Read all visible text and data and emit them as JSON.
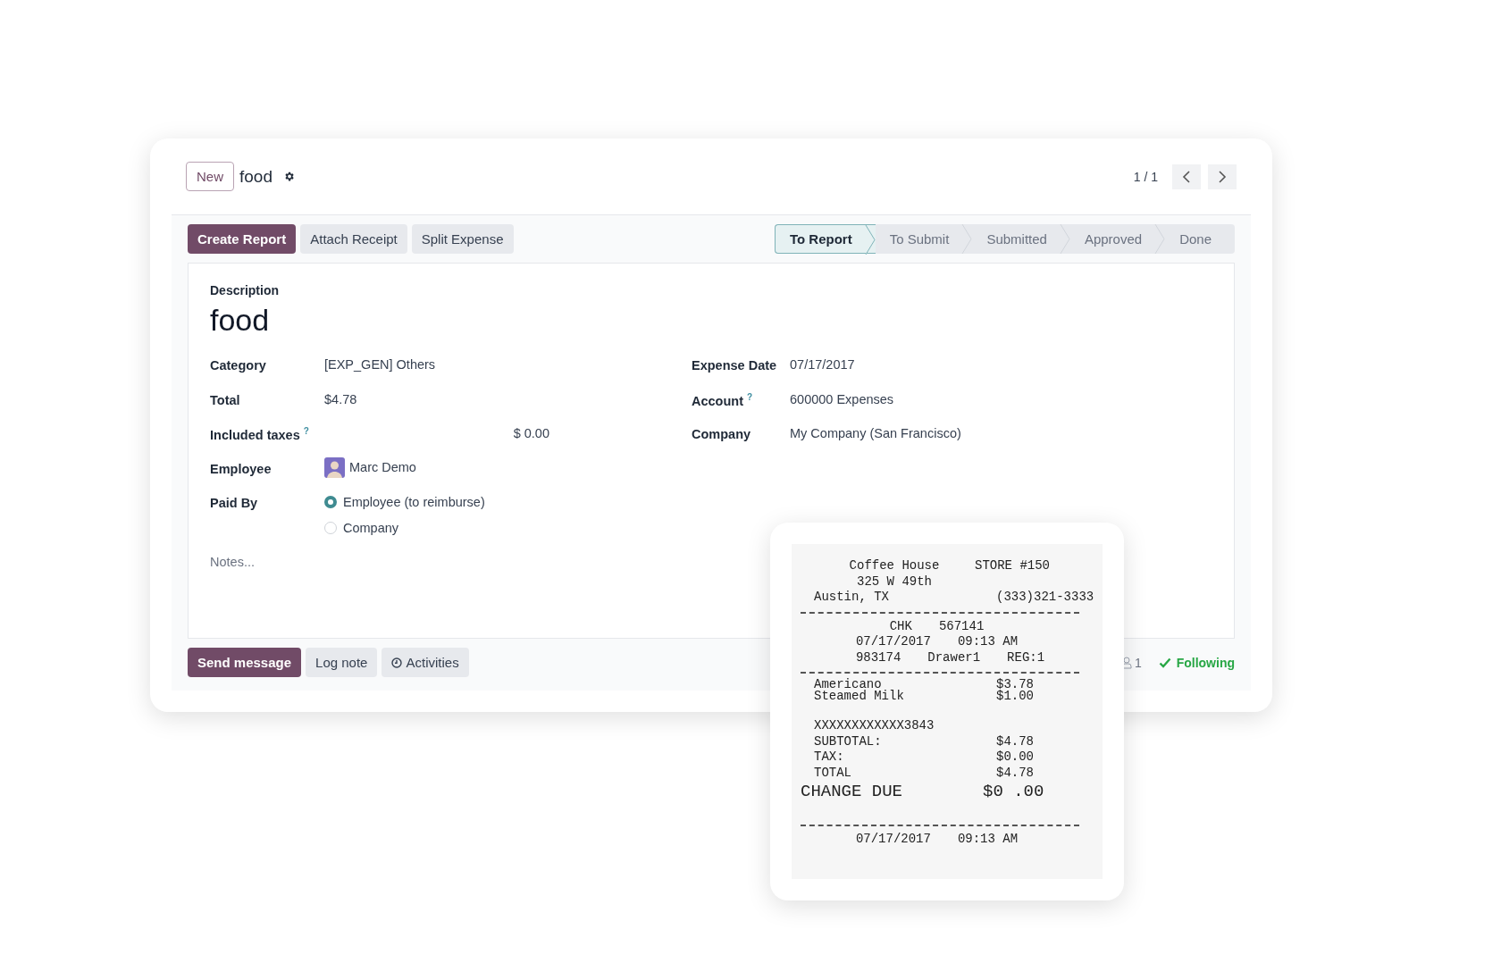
{
  "header": {
    "new_button": "New",
    "record_title": "food",
    "pager": "1 / 1"
  },
  "actions": [
    {
      "label": "Create Report",
      "primary": true
    },
    {
      "label": "Attach Receipt",
      "primary": false
    },
    {
      "label": "Split Expense",
      "primary": false
    }
  ],
  "statuses": [
    {
      "label": "To Report",
      "selected": true
    },
    {
      "label": "To Submit",
      "selected": false
    },
    {
      "label": "Submitted",
      "selected": false
    },
    {
      "label": "Approved",
      "selected": false
    },
    {
      "label": "Done",
      "selected": false
    }
  ],
  "form": {
    "description_label": "Description",
    "description": "food",
    "left_fields": [
      {
        "kind": "text",
        "label": "Category",
        "value": "[EXP_GEN] Others"
      },
      {
        "kind": "text",
        "label": "Total",
        "value": "$4.78"
      },
      {
        "kind": "amount",
        "label": "Included taxes",
        "help": "?",
        "value": "$ 0.00"
      },
      {
        "kind": "person",
        "label": "Employee",
        "value": "Marc Demo"
      },
      {
        "kind": "radio",
        "label": "Paid By",
        "options": [
          {
            "label": "Employee (to reimburse)",
            "selected": true
          },
          {
            "label": "Company",
            "selected": false
          }
        ]
      }
    ],
    "right_fields": [
      {
        "label": "Expense Date",
        "value": "07/17/2017"
      },
      {
        "label": "Account",
        "help": "?",
        "value": "600000 Expenses"
      },
      {
        "label": "Company",
        "value": "My Company (San Francisco)"
      }
    ],
    "notes_placeholder": "Notes..."
  },
  "chatter": {
    "buttons": [
      {
        "label": "Send message",
        "kind": "primary"
      },
      {
        "label": "Log note",
        "kind": "plain"
      },
      {
        "label": "Activities",
        "kind": "activities"
      }
    ],
    "followers": "1",
    "following": "Following"
  },
  "receipt": {
    "lines": [
      {
        "kind": "title",
        "parts": [
          "Coffee House",
          "STORE #150"
        ]
      },
      {
        "kind": "title",
        "parts": [
          "325 W 49th"
        ]
      },
      {
        "kind": "pair",
        "parts": [
          "Austin, TX",
          "(333)321-3333"
        ]
      },
      {
        "kind": "divider"
      },
      {
        "kind": "center",
        "parts": [
          "CHK",
          "567141"
        ]
      },
      {
        "kind": "center",
        "parts": [
          "07/17/2017",
          "09:13 AM"
        ]
      },
      {
        "kind": "center",
        "parts": [
          "983174",
          "Drawer1",
          "REG:1"
        ]
      },
      {
        "kind": "divider"
      },
      {
        "kind": "tight",
        "parts": [
          "Americano",
          "$3.78"
        ]
      },
      {
        "kind": "tight",
        "parts": [
          "Steamed Milk",
          "$1.00"
        ]
      },
      {
        "kind": "blank"
      },
      {
        "kind": "pair",
        "parts": [
          "XXXXXXXXXXXX3843"
        ]
      },
      {
        "kind": "pair",
        "parts": [
          "SUBTOTAL:",
          "$4.78"
        ]
      },
      {
        "kind": "pair",
        "parts": [
          "TAX:",
          "$0.00"
        ]
      },
      {
        "kind": "pair",
        "parts": [
          "TOTAL",
          "$4.78"
        ]
      },
      {
        "kind": "big",
        "parts": [
          "CHANGE DUE",
          "$0 .00"
        ]
      },
      {
        "kind": "blank"
      },
      {
        "kind": "divider"
      },
      {
        "kind": "center",
        "parts": [
          "07/17/2017",
          "09:13 AM"
        ]
      }
    ]
  }
}
